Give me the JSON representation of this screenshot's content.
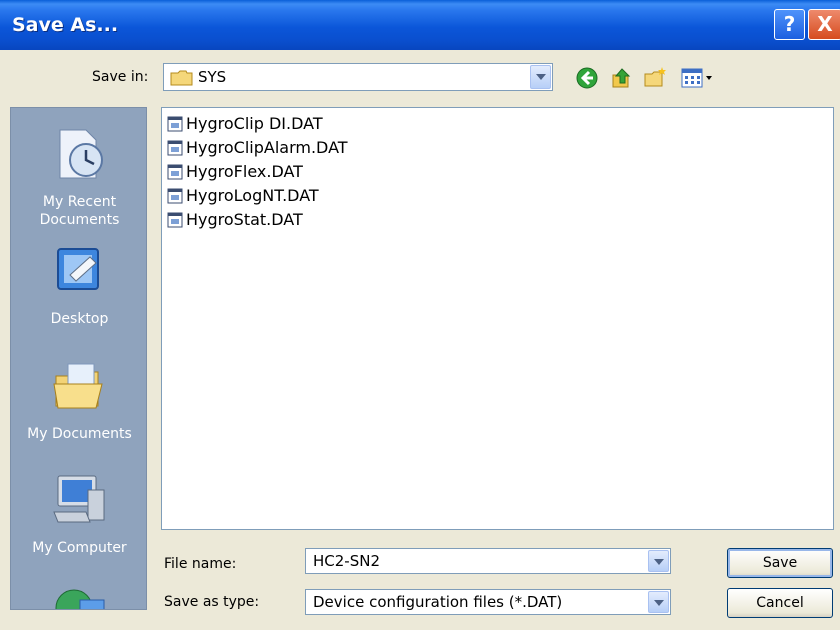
{
  "window": {
    "title": "Save As...",
    "help_label": "?",
    "close_label": "X"
  },
  "save_in": {
    "label": "Save in:",
    "value": "SYS"
  },
  "toolbar": [
    "back-icon",
    "up-folder-icon",
    "new-folder-icon",
    "view-menu-icon"
  ],
  "places": [
    {
      "label": "My Recent Documents"
    },
    {
      "label": "Desktop"
    },
    {
      "label": "My Documents"
    },
    {
      "label": "My Computer"
    },
    {
      "label": ""
    }
  ],
  "files": [
    "HygroClip DI.DAT",
    "HygroClipAlarm.DAT",
    "HygroFlex.DAT",
    "HygroLogNT.DAT",
    "HygroStat.DAT"
  ],
  "file_name": {
    "label": "File name:",
    "value": "HC2-SN2"
  },
  "save_as_type": {
    "label": "Save as type:",
    "value": "Device configuration files (*.DAT)"
  },
  "buttons": {
    "save": "Save",
    "cancel": "Cancel"
  }
}
